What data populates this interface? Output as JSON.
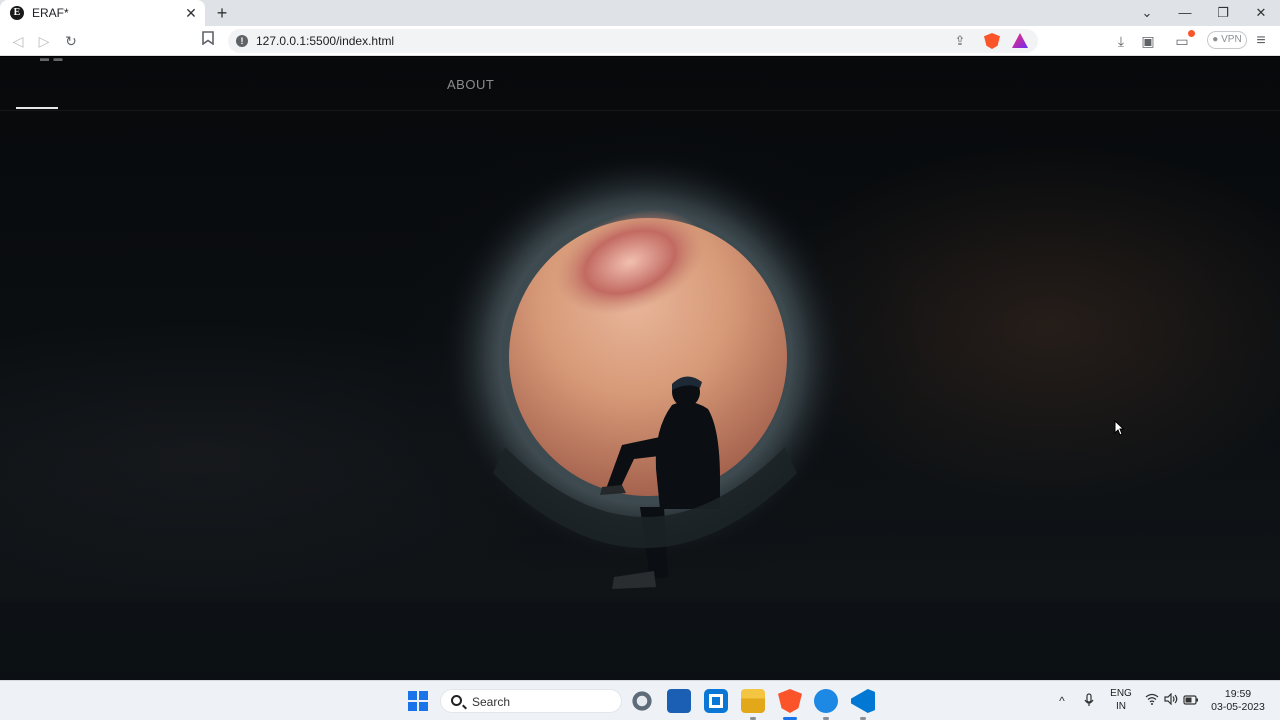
{
  "browser": {
    "tab_title": "ERAF*",
    "favicon_letter": "E",
    "tab_close": "✕",
    "new_tab": "+",
    "url": "127.0.0.1:5500/index.html",
    "vpn_label": "VPN",
    "window_controls": {
      "dropdown": "⌄",
      "minimize": "—",
      "restore": "❐",
      "close": "✕"
    },
    "icons": {
      "back": "◁",
      "forward": "▷",
      "reload": "↻",
      "bookmark": "🔖",
      "share": "⇪",
      "download": "⤓",
      "sidebar": "▣",
      "wallet": "▭",
      "menu": "≡"
    }
  },
  "site": {
    "nav_about": "ABOUT",
    "hero_description": "Silhouette of a person sitting in a large circular concrete window opening with a warm blurred background"
  },
  "taskbar": {
    "search_placeholder": "Search",
    "language_top": "ENG",
    "language_bottom": "IN",
    "time": "19:59",
    "date": "03-05-2023",
    "tray_icons": {
      "chevron": "^",
      "mic": "🎙",
      "wifi": "📶",
      "volume": "🔊",
      "battery": "▭"
    },
    "apps": [
      "settings-app",
      "store-app",
      "outlook-app",
      "file-explorer-app",
      "brave-browser-app",
      "remote-app",
      "vscode-app"
    ]
  },
  "colors": {
    "accent_blue": "#1a73e8",
    "brave_orange": "#fb542b",
    "vscode_blue": "#0078d4",
    "page_background": "#07090b",
    "hero_warm": "#d99a7a"
  }
}
